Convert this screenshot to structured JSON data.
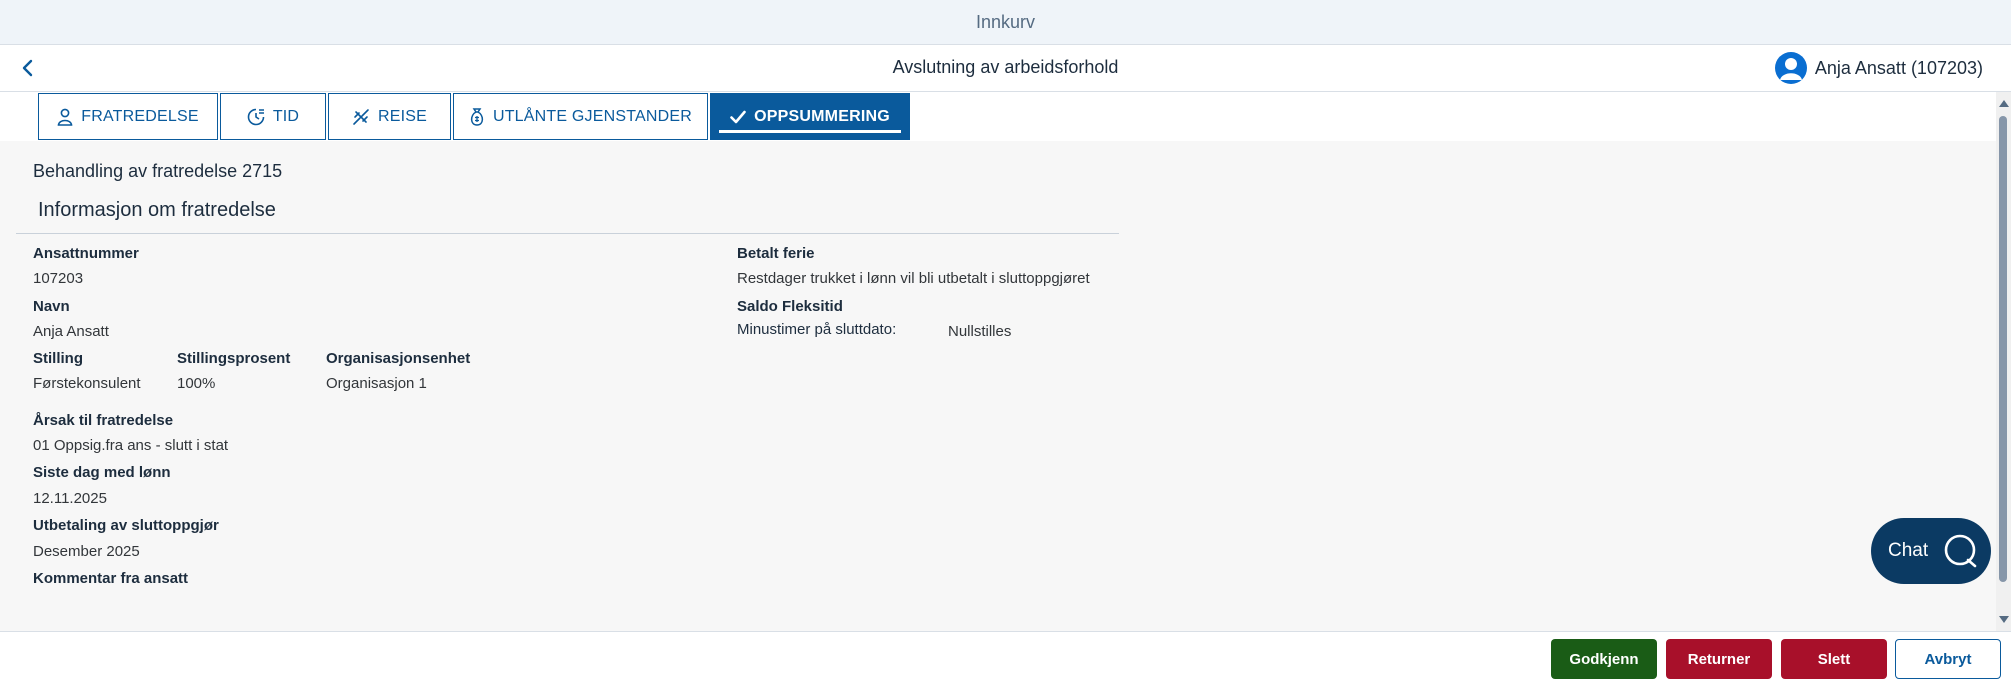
{
  "shellbar": {
    "title": "Innkurv"
  },
  "header": {
    "title": "Avslutning av arbeidsforhold",
    "user": "Anja Ansatt (107203)"
  },
  "tabs": [
    {
      "label": "FRATREDELSE",
      "icon": "person-icon"
    },
    {
      "label": "TID",
      "icon": "clock-icon"
    },
    {
      "label": "REISE",
      "icon": "travel-icon"
    },
    {
      "label": "UTLÅNTE GJENSTANDER",
      "icon": "money-bag-icon"
    },
    {
      "label": "OPPSUMMERING",
      "icon": "checkmark-icon",
      "active": true
    }
  ],
  "content": {
    "case_title": "Behandling av fratredelse 2715",
    "section_title": "Informasjon om fratredelse",
    "left": {
      "ansattnummer_label": "Ansattnummer",
      "ansattnummer_value": "107203",
      "navn_label": "Navn",
      "navn_value": "Anja Ansatt",
      "stilling_label": "Stilling",
      "stilling_value": "Førstekonsulent",
      "stillingsprosent_label": "Stillingsprosent",
      "stillingsprosent_value": "100%",
      "org_label": "Organisasjonsenhet",
      "org_value": "Organisasjon 1",
      "arsak_label": "Årsak til fratredelse",
      "arsak_value": "01 Oppsig.fra ans - slutt i stat",
      "siste_dag_label": "Siste dag med lønn",
      "siste_dag_value": "12.11.2025",
      "utbetaling_label": "Utbetaling av sluttoppgjør",
      "utbetaling_value": "Desember 2025",
      "kommentar_label": "Kommentar fra ansatt"
    },
    "right": {
      "betalt_ferie_label": "Betalt ferie",
      "betalt_ferie_value": "Restdager trukket i lønn vil bli utbetalt i sluttoppgjøret",
      "saldo_label": "Saldo Fleksitid",
      "minustimer_label": "Minustimer på sluttdato:",
      "minustimer_value": "Nullstilles"
    }
  },
  "chat": {
    "label": "Chat"
  },
  "footer": {
    "approve": "Godkjenn",
    "return": "Returner",
    "delete": "Slett",
    "cancel": "Avbryt"
  },
  "colors": {
    "brand": "#0a5a9c",
    "approve": "#1a5c16",
    "danger": "#a8102a",
    "chat": "#0b3a63"
  }
}
